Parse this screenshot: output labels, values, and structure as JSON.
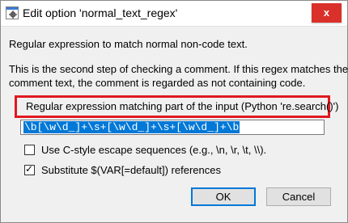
{
  "window": {
    "title": "Edit option 'normal_text_regex'",
    "close_symbol": "x",
    "app_icon": "gear-window-icon"
  },
  "dialog": {
    "heading": "Regular expression to match normal non-code text.",
    "description_line1": "This is the second step of checking a comment. If this regex matches the",
    "description_line2": "comment text, the comment is regarded as not containing code.",
    "field_label": "Regular expression matching part of the input (Python 're.search()')",
    "field_value": "\\b[\\w\\d_]+\\s+[\\w\\d_]+\\s+[\\w\\d_]+\\b",
    "checkbox_escape": {
      "label": "Use C-style escape sequences (e.g., \\n, \\r, \\t, \\\\).",
      "checked": false
    },
    "checkbox_substitute": {
      "label": "Substitute $(VAR[=default]) references",
      "checked": true
    },
    "ok_label": "OK",
    "cancel_label": "Cancel"
  },
  "colors": {
    "accent": "#0078d7",
    "close_button": "#d9312a",
    "highlight_border": "#e0191f"
  }
}
